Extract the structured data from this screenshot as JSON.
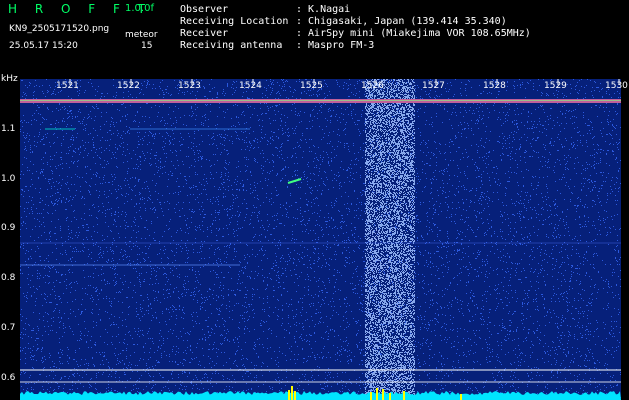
{
  "header": {
    "brand": "H R O F F T",
    "version": "1.0.0f",
    "filename": "KN9_2505171520.png",
    "datetime": "25.05.17 15:20",
    "meteor_label": "meteor",
    "meteor_count": "15",
    "observer_label": "Observer",
    "observer_value": ": K.Nagai",
    "location_label": "Receiving Location",
    "location_value": ": Chigasaki, Japan (139.414 35.340)",
    "receiver_label": "Receiver",
    "receiver_value": ": AirSpy mini (Miakejima VOR 108.65MHz)",
    "antenna_label": "Receiving antenna",
    "antenna_value": ": Maspro FM-3"
  },
  "axes": {
    "y_unit": "kHz",
    "y_ticks": [
      "1.1",
      "1.0",
      "0.9",
      "0.8",
      "0.7",
      "0.6"
    ],
    "x_ticks": [
      "1521",
      "1522",
      "1523",
      "1524",
      "1525",
      "1526",
      "1527",
      "1528",
      "1529",
      "1530"
    ]
  },
  "colors": {
    "background": "#06207a",
    "noise": "#3a6cff",
    "header_green": "#00ff66",
    "power_trace": "#00e5ff",
    "meteor_echo": "#ffff00"
  }
}
